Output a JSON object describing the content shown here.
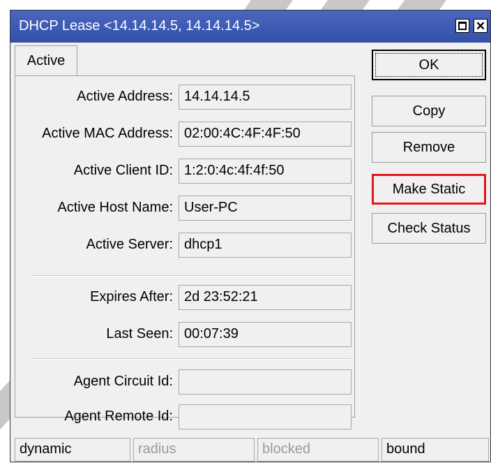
{
  "window": {
    "title": "DHCP Lease <14.14.14.5, 14.14.14.5>"
  },
  "tabs": [
    {
      "label": "Active"
    }
  ],
  "fields": [
    {
      "label": "Active Address:",
      "value": "14.14.14.5"
    },
    {
      "label": "Active MAC Address:",
      "value": "02:00:4C:4F:4F:50"
    },
    {
      "label": "Active Client ID:",
      "value": "1:2:0:4c:4f:4f:50"
    },
    {
      "label": "Active Host Name:",
      "value": "User-PC"
    },
    {
      "label": "Active Server:",
      "value": "dhcp1"
    },
    {
      "label": "Expires After:",
      "value": "2d 23:52:21"
    },
    {
      "label": "Last Seen:",
      "value": "00:07:39"
    },
    {
      "label": "Agent Circuit Id:",
      "value": ""
    },
    {
      "label": "Agent Remote Id:",
      "value": ""
    }
  ],
  "buttons": {
    "ok": "OK",
    "copy": "Copy",
    "remove": "Remove",
    "make_static": "Make Static",
    "check_status": "Check Status"
  },
  "status": {
    "dynamic": "dynamic",
    "radius": "radius",
    "blocked": "blocked",
    "bound": "bound"
  },
  "colors": {
    "titlebar": "#3e5ab3",
    "highlight": "#e5161d"
  }
}
